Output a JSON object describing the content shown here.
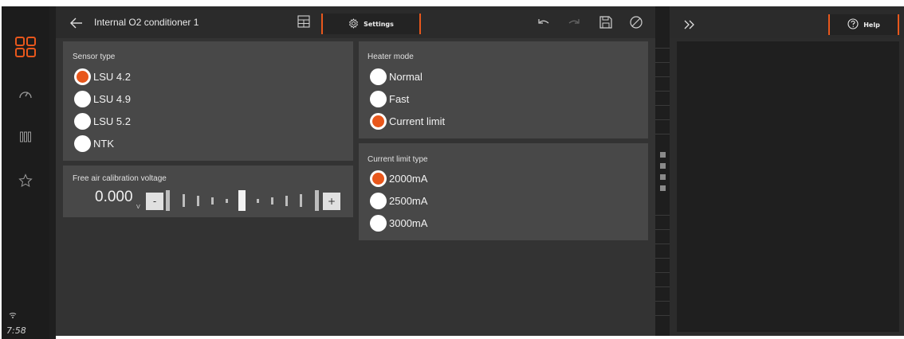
{
  "sidebar": {
    "time": "7:58",
    "icons": [
      "apps-grid-icon",
      "gauge-icon",
      "bars-icon",
      "star-icon",
      "wifi-icon"
    ],
    "accent": "#e8571c"
  },
  "header": {
    "title": "Internal O2 conditioner 1",
    "settings_label": "Settings"
  },
  "sensor_type": {
    "title": "Sensor type",
    "options": [
      {
        "label": "LSU 4.2",
        "selected": true
      },
      {
        "label": "LSU 4.9",
        "selected": false
      },
      {
        "label": "LSU 5.2",
        "selected": false
      },
      {
        "label": "NTK",
        "selected": false
      }
    ]
  },
  "calibration": {
    "title": "Free air calibration voltage",
    "value": "0.000",
    "unit": "V",
    "minus_label": "-",
    "plus_label": "+"
  },
  "heater_mode": {
    "title": "Heater mode",
    "options": [
      {
        "label": "Normal",
        "selected": false
      },
      {
        "label": "Fast",
        "selected": false
      },
      {
        "label": "Current limit",
        "selected": true
      }
    ]
  },
  "current_limit": {
    "title": "Current limit type",
    "options": [
      {
        "label": "2000mA",
        "selected": true
      },
      {
        "label": "2500mA",
        "selected": false
      },
      {
        "label": "3000mA",
        "selected": false
      }
    ]
  },
  "right_panel": {
    "help_label": "Help"
  }
}
